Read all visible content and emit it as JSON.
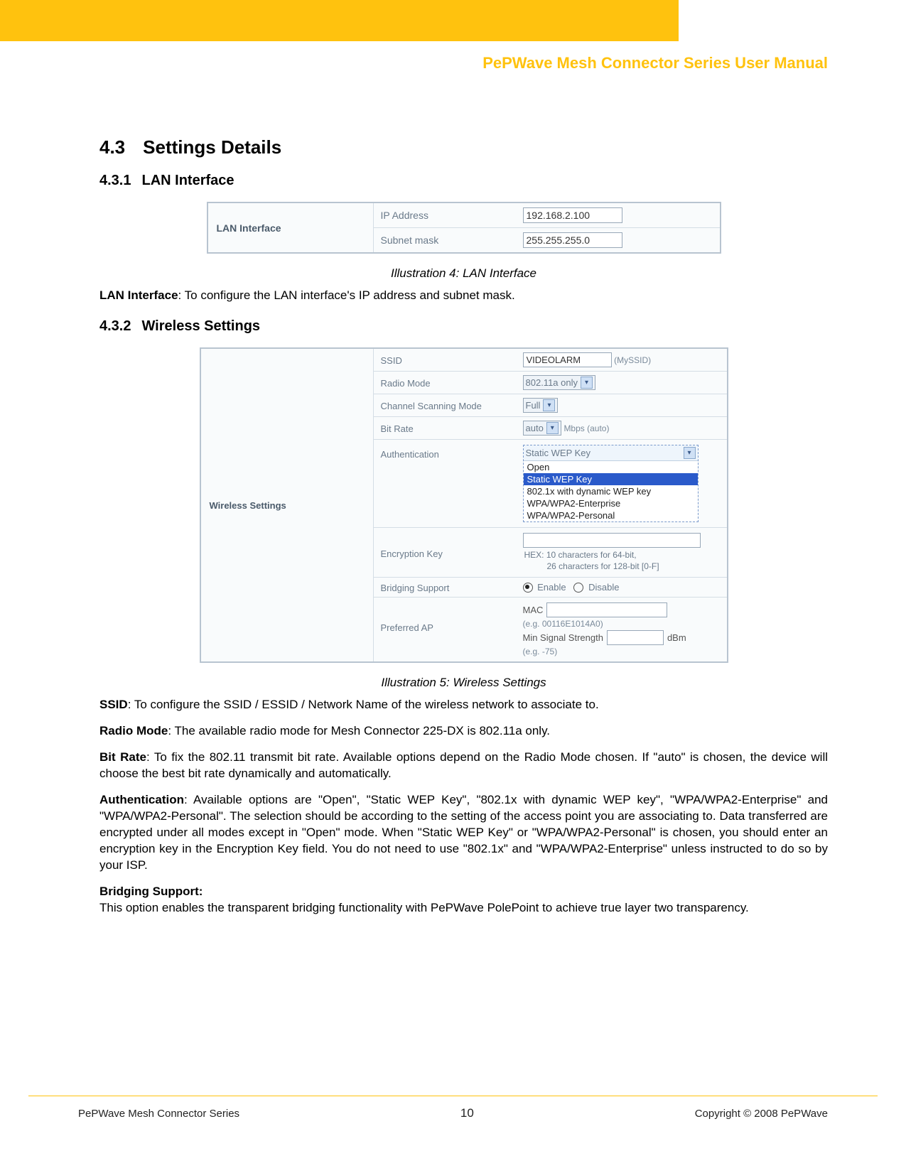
{
  "header": {
    "title": "PePWave Mesh Connector Series User Manual"
  },
  "section": {
    "num": "4.3",
    "title": "Settings Details"
  },
  "sub1": {
    "num": "4.3.1",
    "title": "LAN Interface"
  },
  "lan_table": {
    "section_label": "LAN Interface",
    "ip_label": "IP Address",
    "ip_value": "192.168.2.100",
    "mask_label": "Subnet mask",
    "mask_value": "255.255.255.0"
  },
  "illus4": "Illustration 4: LAN Interface",
  "lan_desc": {
    "term": "LAN Interface",
    "body": ": To configure the LAN interface's IP address and subnet mask."
  },
  "sub2": {
    "num": "4.3.2",
    "title": "Wireless Settings"
  },
  "wl": {
    "section_label": "Wireless Settings",
    "ssid_label": "SSID",
    "ssid_value": "VIDEOLARM",
    "ssid_hint": "(MySSID)",
    "radio_label": "Radio Mode",
    "radio_value": "802.11a only",
    "scan_label": "Channel Scanning Mode",
    "scan_value": "Full",
    "bitrate_label": "Bit Rate",
    "bitrate_value": "auto",
    "bitrate_hint": "Mbps (auto)",
    "auth_label": "Authentication",
    "auth_selected": "Static WEP Key",
    "auth_options": [
      "Open",
      "Static WEP Key",
      "802.1x with dynamic WEP key",
      "WPA/WPA2-Enterprise",
      "WPA/WPA2-Personal"
    ],
    "enc_label": "Encryption Key",
    "enc_hex1": "HEX: 10 characters for 64-bit,",
    "enc_hex2": "26 characters for 128-bit [0-F]",
    "bridge_label": "Bridging Support",
    "bridge_enable": "Enable",
    "bridge_disable": "Disable",
    "pref_label": "Preferred AP",
    "mac_label": "MAC",
    "mac_eg": "(e.g. 00116E1014A0)",
    "minsig_label": "Min Signal Strength",
    "minsig_unit": "dBm",
    "minsig_eg": "(e.g. -75)"
  },
  "illus5": "Illustration 5: Wireless Settings",
  "p_ssid": {
    "term": "SSID",
    "body": ": To configure the SSID / ESSID / Network Name of the wireless network to associate to."
  },
  "p_radio": {
    "term": "Radio Mode",
    "body": ": The available radio mode for Mesh Connector 225-DX is 802.11a only."
  },
  "p_bit": {
    "term": "Bit Rate",
    "body": ": To fix the 802.11 transmit bit rate.  Available options depend on the Radio Mode chosen.  If \"auto\" is chosen, the device will choose the best bit rate dynamically and automatically."
  },
  "p_auth": {
    "term": "Authentication",
    "body": ": Available options are \"Open\", \"Static WEP Key\", \"802.1x with dynamic WEP key\", \"WPA/WPA2-Enterprise\" and \"WPA/WPA2-Personal\". The selection should be according to the setting of the access point you are associating to.  Data transferred are encrypted under all modes except in \"Open\" mode.  When \"Static WEP Key\" or \"WPA/WPA2-Personal\" is chosen, you should enter an encryption key in the Encryption Key field.  You do not need to use \"802.1x\" and \"WPA/WPA2-Enterprise\" unless instructed to do so by your ISP."
  },
  "p_bridge_h": "Bridging Support:",
  "p_bridge": "This option enables the transparent bridging functionality with PePWave PolePoint to achieve true layer two transparency.",
  "footer": {
    "left": "PePWave  Mesh Connector Series",
    "page": "10",
    "right": "Copyright © 2008 PePWave"
  }
}
